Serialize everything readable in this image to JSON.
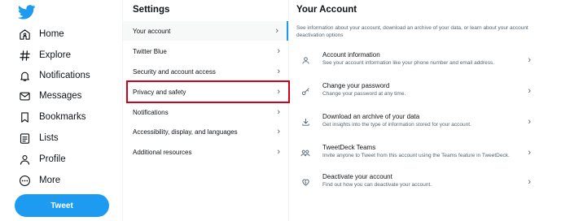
{
  "nav": {
    "items": [
      {
        "label": "Home",
        "icon": "home-icon"
      },
      {
        "label": "Explore",
        "icon": "hashtag-icon"
      },
      {
        "label": "Notifications",
        "icon": "bell-icon"
      },
      {
        "label": "Messages",
        "icon": "envelope-icon"
      },
      {
        "label": "Bookmarks",
        "icon": "bookmark-icon"
      },
      {
        "label": "Lists",
        "icon": "list-icon"
      },
      {
        "label": "Profile",
        "icon": "person-icon"
      },
      {
        "label": "More",
        "icon": "more-icon"
      }
    ],
    "tweet_label": "Tweet"
  },
  "settings": {
    "title": "Settings",
    "items": [
      {
        "label": "Your account",
        "active": true
      },
      {
        "label": "Twitter Blue"
      },
      {
        "label": "Security and account access"
      },
      {
        "label": "Privacy and safety",
        "highlighted": true
      },
      {
        "label": "Notifications"
      },
      {
        "label": "Accessibility, display, and languages"
      },
      {
        "label": "Additional resources"
      }
    ]
  },
  "account": {
    "title": "Your Account",
    "description": "See information about your account, download an archive of your data, or learn about your account deactivation options",
    "items": [
      {
        "title": "Account information",
        "desc": "See your account information like your phone number and email address.",
        "icon": "person-icon"
      },
      {
        "title": "Change your password",
        "desc": "Change your password at any time.",
        "icon": "key-icon"
      },
      {
        "title": "Download an archive of your data",
        "desc": "Get insights into the type of information stored for your account.",
        "icon": "download-icon"
      },
      {
        "title": "TweetDeck Teams",
        "desc": "Invite anyone to Tweet from this account using the Teams feature in TweetDeck.",
        "icon": "people-icon"
      },
      {
        "title": "Deactivate your account",
        "desc": "Find out how you can deactivate your account.",
        "icon": "broken-heart-icon"
      }
    ]
  },
  "colors": {
    "brand": "#1d9bf0",
    "highlight": "#d0021b"
  }
}
